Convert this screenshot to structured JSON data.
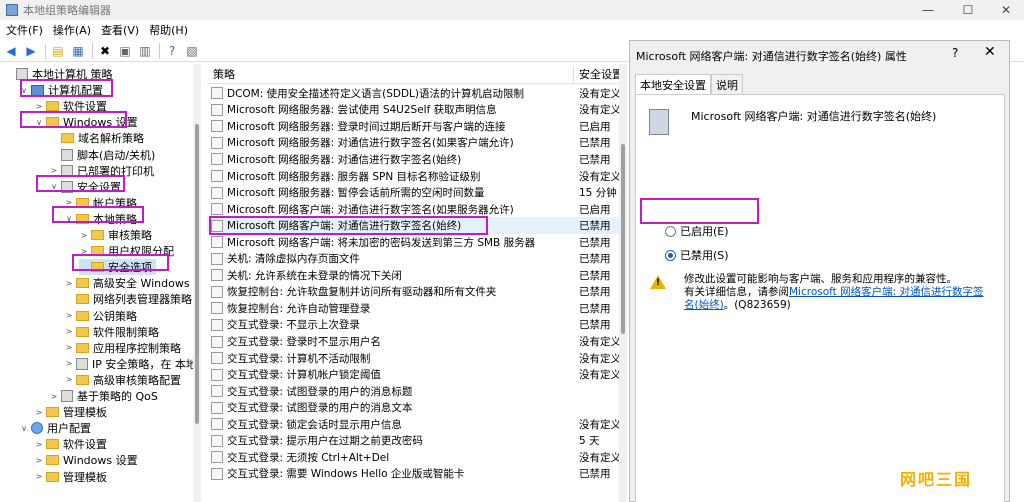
{
  "window": {
    "title": "本地组策略编辑器"
  },
  "menu": [
    "文件(F)",
    "操作(A)",
    "查看(V)",
    "帮助(H)"
  ],
  "tree": [
    {
      "label": "本地计算机 策略",
      "level": 0,
      "icon": "policy-icon",
      "expand": ""
    },
    {
      "label": "计算机配置",
      "level": 1,
      "icon": "computer-icon",
      "expand": "∨"
    },
    {
      "label": "软件设置",
      "level": 2,
      "icon": "folder-icon",
      "expand": ">"
    },
    {
      "label": "Windows 设置",
      "level": 2,
      "icon": "folder-icon",
      "expand": "∨"
    },
    {
      "label": "域名解析策略",
      "level": 3,
      "icon": "folder-icon",
      "expand": ""
    },
    {
      "label": "脚本(启动/关机)",
      "level": 3,
      "icon": "script-icon",
      "expand": ""
    },
    {
      "label": "已部署的打印机",
      "level": 3,
      "icon": "printer-icon",
      "expand": ">"
    },
    {
      "label": "安全设置",
      "level": 3,
      "icon": "security-icon",
      "expand": "∨"
    },
    {
      "label": "帐户策略",
      "level": 4,
      "icon": "folder-icon",
      "expand": ">"
    },
    {
      "label": "本地策略",
      "level": 4,
      "icon": "folder-icon",
      "expand": "∨"
    },
    {
      "label": "审核策略",
      "level": 5,
      "icon": "folder-icon",
      "expand": ">"
    },
    {
      "label": "用户权限分配",
      "level": 5,
      "icon": "folder-icon",
      "expand": ">"
    },
    {
      "label": "安全选项",
      "level": 5,
      "icon": "folder-icon",
      "expand": ""
    },
    {
      "label": "高级安全 Windows Defer",
      "level": 4,
      "icon": "folder-icon",
      "expand": ">"
    },
    {
      "label": "网络列表管理器策略",
      "level": 4,
      "icon": "folder-icon",
      "expand": ""
    },
    {
      "label": "公钥策略",
      "level": 4,
      "icon": "folder-icon",
      "expand": ">"
    },
    {
      "label": "软件限制策略",
      "level": 4,
      "icon": "folder-icon",
      "expand": ">"
    },
    {
      "label": "应用程序控制策略",
      "level": 4,
      "icon": "folder-icon",
      "expand": ">"
    },
    {
      "label": "IP 安全策略，在 本地计算",
      "level": 4,
      "icon": "ipsec-icon",
      "expand": ">"
    },
    {
      "label": "高级审核策略配置",
      "level": 4,
      "icon": "folder-icon",
      "expand": ">"
    },
    {
      "label": "基于策略的 QoS",
      "level": 3,
      "icon": "qos-icon",
      "expand": ">"
    },
    {
      "label": "管理模板",
      "level": 2,
      "icon": "folder-icon",
      "expand": ">"
    },
    {
      "label": "用户配置",
      "level": 1,
      "icon": "user-icon",
      "expand": "∨"
    },
    {
      "label": "软件设置",
      "level": 2,
      "icon": "folder-icon",
      "expand": ">"
    },
    {
      "label": "Windows 设置",
      "level": 2,
      "icon": "folder-icon",
      "expand": ">"
    },
    {
      "label": "管理模板",
      "level": 2,
      "icon": "folder-icon",
      "expand": ">"
    }
  ],
  "list": {
    "col_policy": "策略",
    "col_setting": "安全设置",
    "rows": [
      {
        "name": "DCOM: 使用安全描述符定义语言(SDDL)语法的计算机启动限制",
        "setting": "没有定义"
      },
      {
        "name": "Microsoft 网络服务器: 尝试使用 S4U2Self 获取声明信息",
        "setting": "没有定义"
      },
      {
        "name": "Microsoft 网络服务器: 登录时间过期后断开与客户端的连接",
        "setting": "已启用"
      },
      {
        "name": "Microsoft 网络服务器: 对通信进行数字签名(如果客户端允许)",
        "setting": "已禁用"
      },
      {
        "name": "Microsoft 网络服务器: 对通信进行数字签名(始终)",
        "setting": "已禁用"
      },
      {
        "name": "Microsoft 网络服务器: 服务器 SPN 目标名称验证级别",
        "setting": "没有定义"
      },
      {
        "name": "Microsoft 网络服务器: 暂停会话前所需的空闲时间数量",
        "setting": "15 分钟"
      },
      {
        "name": "Microsoft 网络客户端: 对通信进行数字签名(如果服务器允许)",
        "setting": "已启用"
      },
      {
        "name": "Microsoft 网络客户端: 对通信进行数字签名(始终)",
        "setting": "已禁用"
      },
      {
        "name": "Microsoft 网络客户端: 将未加密的密码发送到第三方 SMB 服务器",
        "setting": "已禁用"
      },
      {
        "name": "关机: 清除虚拟内存页面文件",
        "setting": "已禁用"
      },
      {
        "name": "关机: 允许系统在未登录的情况下关闭",
        "setting": "已禁用"
      },
      {
        "name": "恢复控制台: 允许软盘复制并访问所有驱动器和所有文件夹",
        "setting": "已禁用"
      },
      {
        "name": "恢复控制台: 允许自动管理登录",
        "setting": "已禁用"
      },
      {
        "name": "交互式登录: 不显示上次登录",
        "setting": "已禁用"
      },
      {
        "name": "交互式登录: 登录时不显示用户名",
        "setting": "没有定义"
      },
      {
        "name": "交互式登录: 计算机不活动限制",
        "setting": "没有定义"
      },
      {
        "name": "交互式登录: 计算机帐户锁定阈值",
        "setting": "没有定义"
      },
      {
        "name": "交互式登录: 试图登录的用户的消息标题",
        "setting": ""
      },
      {
        "name": "交互式登录: 试图登录的用户的消息文本",
        "setting": ""
      },
      {
        "name": "交互式登录: 锁定会话时显示用户信息",
        "setting": "没有定义"
      },
      {
        "name": "交互式登录: 提示用户在过期之前更改密码",
        "setting": "5 天"
      },
      {
        "name": "交互式登录: 无须按 Ctrl+Alt+Del",
        "setting": "没有定义"
      },
      {
        "name": "交互式登录: 需要 Windows Hello 企业版或智能卡",
        "setting": "已禁用"
      }
    ]
  },
  "dialog": {
    "title": "Microsoft 网络客户端: 对通信进行数字签名(始终) 属性",
    "help": "?",
    "close": "✕",
    "tabs": [
      "本地安全设置",
      "说明"
    ],
    "policy_name": "Microsoft 网络客户端: 对通信进行数字签名(始终)",
    "radio_enabled": "已启用(E)",
    "radio_disabled": "已禁用(S)",
    "selected": "disabled",
    "warning_line1": "修改此设置可能影响与客户端、服务和应用程序的兼容性。",
    "warning_line2": "有关详细信息，请参阅",
    "warning_link": "Microsoft 网络客户端: 对通信进行数字签名(始终)",
    "warning_ref": "。(Q823659)"
  },
  "watermark": "网吧三国"
}
